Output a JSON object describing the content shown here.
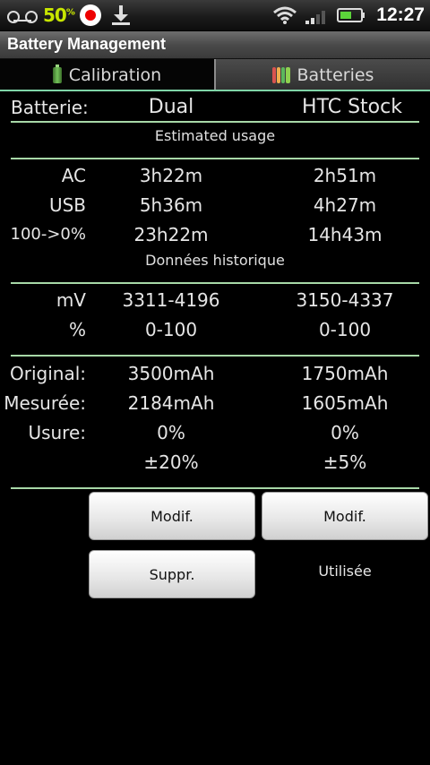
{
  "status_bar": {
    "battery_percent": "50",
    "battery_percent_sup": "%",
    "time": "12:27",
    "icons": [
      "voicemail-icon",
      "record-icon",
      "download-icon",
      "wifi-icon",
      "signal-icon",
      "battery-icon"
    ]
  },
  "app": {
    "title": "Battery Management"
  },
  "tabs": [
    {
      "label": "Calibration",
      "icon": "battery-icon",
      "selected": false
    },
    {
      "label": "Batteries",
      "icon": "batteries-icon",
      "selected": true
    }
  ],
  "header": {
    "label": "Batterie:",
    "col1": "Dual",
    "col2": "HTC Stock"
  },
  "estimated": {
    "title": "Estimated usage",
    "rows": [
      {
        "label": "AC",
        "col1": "3h22m",
        "col2": "2h51m"
      },
      {
        "label": "USB",
        "col1": "5h36m",
        "col2": "4h27m"
      },
      {
        "label": "100->0%",
        "col1": "23h22m",
        "col2": "14h43m"
      }
    ]
  },
  "historical": {
    "title": "Données historique",
    "rows": [
      {
        "label": "mV",
        "col1": "3311-4196",
        "col2": "3150-4337"
      },
      {
        "label": "%",
        "col1": "0-100",
        "col2": "0-100"
      }
    ]
  },
  "capacity": {
    "rows": [
      {
        "label": "Original:",
        "col1": "3500mAh",
        "col2": "1750mAh"
      },
      {
        "label": "Mesurée:",
        "col1": "2184mAh",
        "col2": "1605mAh"
      },
      {
        "label": "Usure:",
        "col1": "0%",
        "col2": "0%"
      },
      {
        "label": "",
        "col1": "±20%",
        "col2": "±5%"
      }
    ]
  },
  "actions": {
    "modify_1": "Modif.",
    "modify_2": "Modif.",
    "delete_1": "Suppr.",
    "status_2": "Utilisée"
  },
  "colors": {
    "accent_line": "#7fd4a7",
    "separator": "#a7d8a7",
    "battery_pct": "#c8e600"
  }
}
